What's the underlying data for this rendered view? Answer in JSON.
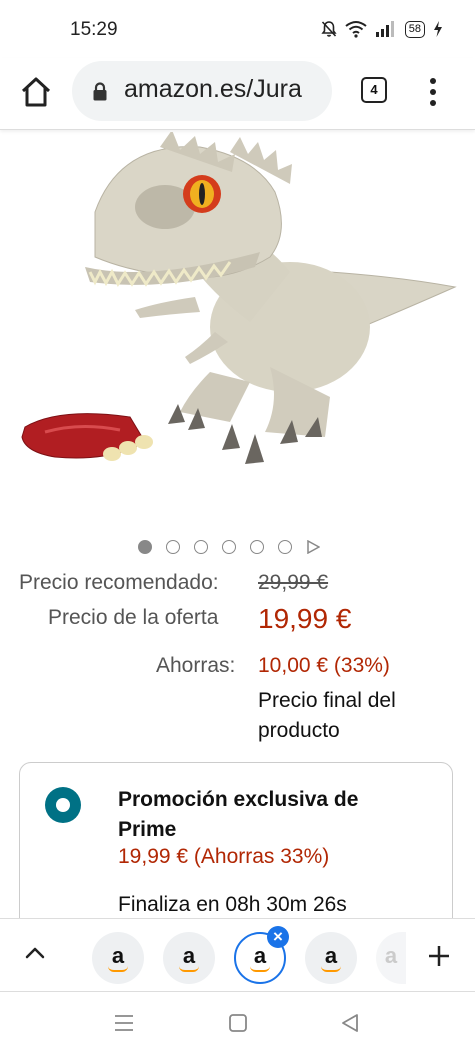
{
  "status_bar": {
    "time": "15:29",
    "battery": "58",
    "icons": [
      "mute-bell-icon",
      "wifi-icon",
      "signal-icon",
      "battery-icon",
      "charging-icon"
    ]
  },
  "browser": {
    "url": "amazon.es/Jura",
    "tab_count": "4"
  },
  "carousel": {
    "total_dots": 6,
    "active_index": 0
  },
  "pricing": {
    "recommended_label": "Precio recomendado:",
    "recommended_value": "29,99 €",
    "offer_label": "Precio de la oferta",
    "offer_value": "19,99 €",
    "savings_label": "Ahorras:",
    "savings_value": "10,00 € (33%)",
    "final_note": "Precio final del producto"
  },
  "promo": {
    "title": "Promoción exclusiva de Prime",
    "price": "19,99 € (Ahorras 33%)",
    "ends": "Finaliza en 08h 30m 26s"
  },
  "tab_switcher": {
    "tab_letter": "a"
  },
  "colors": {
    "price_red": "#B12704",
    "radio_teal": "#007185",
    "active_tab_blue": "#1a73e8",
    "amazon_orange": "#ff9900"
  }
}
